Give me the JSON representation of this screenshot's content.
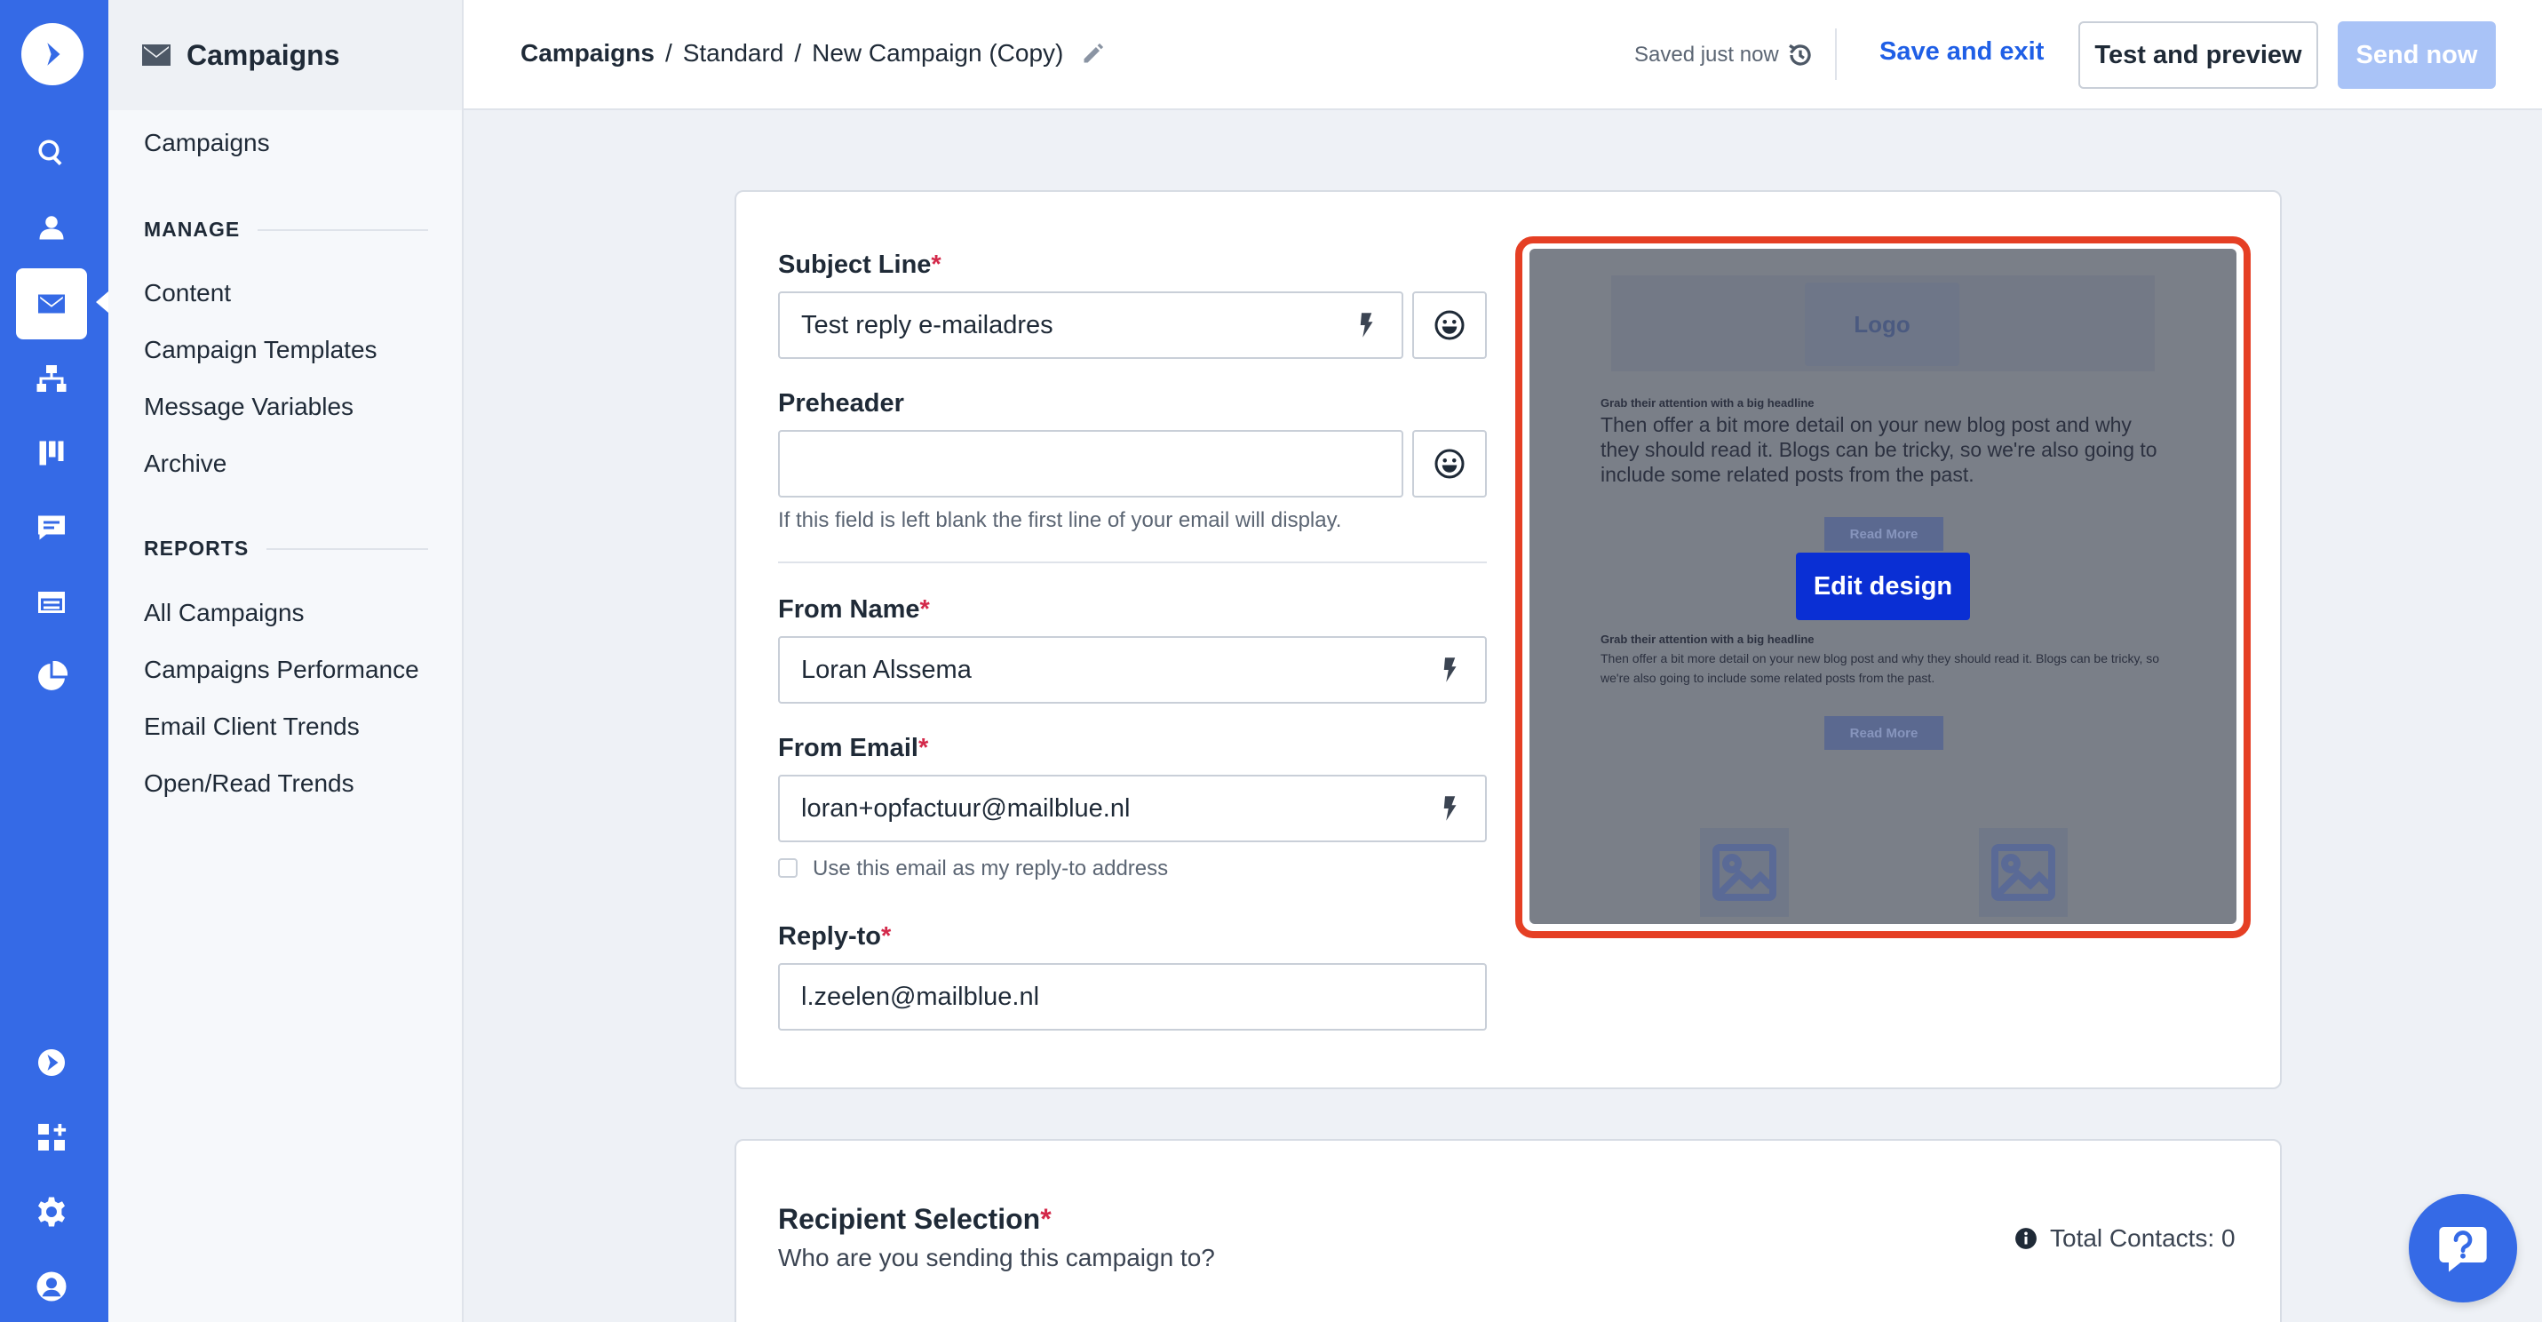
{
  "sidebar": {
    "title": "Campaigns",
    "top_link": "Campaigns",
    "manage_heading": "MANAGE",
    "manage_items": [
      "Content",
      "Campaign Templates",
      "Message Variables",
      "Archive"
    ],
    "reports_heading": "REPORTS",
    "reports_items": [
      "All Campaigns",
      "Campaigns Performance",
      "Email Client Trends",
      "Open/Read Trends"
    ]
  },
  "rail": {
    "icons": [
      "logo-icon",
      "search-icon",
      "contacts-icon",
      "campaigns-icon",
      "automations-icon",
      "deals-icon",
      "conversations-icon",
      "site-icon",
      "reports-icon",
      "getting-started-icon",
      "apps-icon",
      "settings-icon",
      "account-avatar"
    ],
    "active": "campaigns-icon",
    "accent": "#356ae6"
  },
  "header": {
    "crumb_1": "Campaigns",
    "crumb_2": "Standard",
    "crumb_3": "New Campaign (Copy)",
    "separator": "/",
    "saved_status": "Saved just now",
    "save_exit": "Save and exit",
    "test_preview": "Test and preview",
    "send_now": "Send now"
  },
  "form": {
    "required_mark": "*",
    "subject_label": "Subject Line",
    "subject_value": "Test reply e-mailadres",
    "preheader_label": "Preheader",
    "preheader_value": "",
    "preheader_hint": "If this field is left blank the first line of your email will display.",
    "from_name_label": "From Name",
    "from_name_value": "Loran Alssema",
    "from_email_label": "From Email",
    "from_email_value": "loran+opfactuur@mailblue.nl",
    "reply_checkbox_label": "Use this email as my reply-to address",
    "reply_checkbox_checked": false,
    "reply_to_label": "Reply-to",
    "reply_to_value": "l.zeelen@mailblue.nl"
  },
  "preview": {
    "logo_text": "Logo",
    "headline_1": "Grab their attention with a big headline",
    "body_1": "Then offer a bit more detail on your new blog post and why they should read it. Blogs can be tricky, so we're also going to include some related posts from the past.",
    "button_1": "Read More",
    "headline_2": "Grab their attention with a big headline",
    "body_2": "Then offer a bit more detail on your new blog post and why they should read it. Blogs can be tricky, so we're also going to include some related posts from the past.",
    "button_2": "Read More",
    "edit_button": "Edit design",
    "highlight_color": "#e53f24"
  },
  "recipients": {
    "title": "Recipient Selection",
    "subtitle": "Who are you sending this campaign to?",
    "total_contacts": "Total Contacts: 0"
  }
}
